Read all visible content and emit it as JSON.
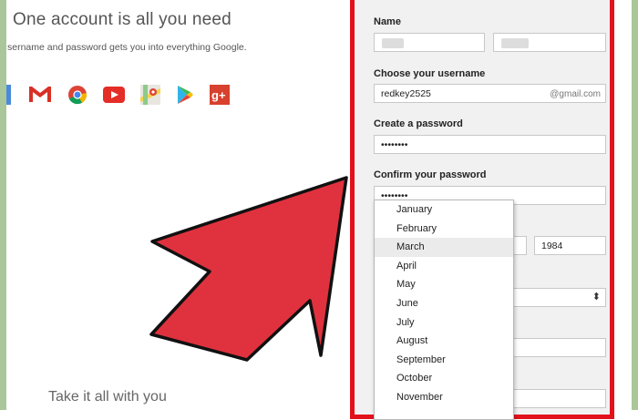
{
  "intro": {
    "headline": "One account is all you need",
    "subline": "sername and password gets you into everything Google.",
    "tagline": "Take it all with you"
  },
  "product_icons": [
    "gmail-icon",
    "chrome-icon",
    "youtube-icon",
    "maps-icon",
    "play-icon",
    "google-plus-icon"
  ],
  "form": {
    "name_label": "Name",
    "username_label": "Choose your username",
    "username_value": "redkey2525",
    "username_suffix": "@gmail.com",
    "password_label": "Create a password",
    "password_value": "••••••••",
    "confirm_label": "Confirm your password",
    "confirm_value": "••••••••",
    "birth_year": "1984"
  },
  "month_dropdown": {
    "items": [
      "January",
      "February",
      "March",
      "April",
      "May",
      "June",
      "July",
      "August",
      "September",
      "October",
      "November"
    ],
    "highlighted": "March"
  },
  "colors": {
    "highlight_border": "#e2121c",
    "arrow_fill": "#e0323e"
  }
}
